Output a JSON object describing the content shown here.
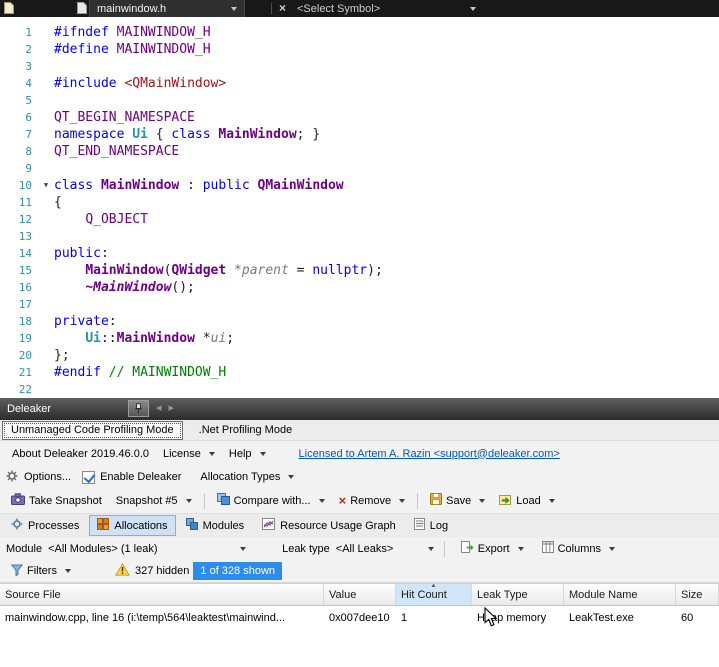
{
  "icons": {
    "dropdown": "▾",
    "close": "×",
    "remove": "×",
    "back": "◂",
    "forward": "▸",
    "fold": "▼",
    "sort": "▲"
  },
  "editor_bar": {
    "tab_title": "mainwindow.h",
    "symbol_selector": "<Select Symbol>"
  },
  "editor": {
    "lines": [
      {
        "n": "1",
        "s": [
          {
            "t": "#ifndef ",
            "c": "kw"
          },
          {
            "t": "MAINWINDOW_H",
            "c": "macro"
          }
        ]
      },
      {
        "n": "2",
        "s": [
          {
            "t": "#define ",
            "c": "kw"
          },
          {
            "t": "MAINWINDOW_H",
            "c": "macro"
          }
        ]
      },
      {
        "n": "3",
        "s": []
      },
      {
        "n": "4",
        "s": [
          {
            "t": "#include ",
            "c": "kw"
          },
          {
            "t": "<QMainWindow>",
            "c": "inc"
          }
        ]
      },
      {
        "n": "5",
        "s": []
      },
      {
        "n": "6",
        "s": [
          {
            "t": "QT_BEGIN_NAMESPACE",
            "c": "macro"
          }
        ]
      },
      {
        "n": "7",
        "s": [
          {
            "t": "namespace ",
            "c": "kw"
          },
          {
            "t": "Ui",
            "c": "ns"
          },
          {
            "t": " { ",
            "c": "pl"
          },
          {
            "t": "class ",
            "c": "kw"
          },
          {
            "t": "MainWindow",
            "c": "cls"
          },
          {
            "t": "; }",
            "c": "pl"
          }
        ]
      },
      {
        "n": "8",
        "s": [
          {
            "t": "QT_END_NAMESPACE",
            "c": "macro"
          }
        ]
      },
      {
        "n": "9",
        "s": []
      },
      {
        "n": "10",
        "fold": true,
        "s": [
          {
            "t": "class ",
            "c": "kw"
          },
          {
            "t": "MainWindow",
            "c": "cls"
          },
          {
            "t": " : ",
            "c": "pl"
          },
          {
            "t": "public ",
            "c": "kw"
          },
          {
            "t": "QMainWindow",
            "c": "cls"
          }
        ]
      },
      {
        "n": "11",
        "s": [
          {
            "t": "{",
            "c": "pl"
          }
        ]
      },
      {
        "n": "12",
        "s": [
          {
            "t": "    ",
            "c": "pl"
          },
          {
            "t": "Q_OBJECT",
            "c": "macro"
          }
        ]
      },
      {
        "n": "13",
        "s": []
      },
      {
        "n": "14",
        "s": [
          {
            "t": "public",
            "c": "kw"
          },
          {
            "t": ":",
            "c": "pl"
          }
        ]
      },
      {
        "n": "15",
        "s": [
          {
            "t": "    ",
            "c": "pl"
          },
          {
            "t": "MainWindow",
            "c": "cls"
          },
          {
            "t": "(",
            "c": "pl"
          },
          {
            "t": "QWidget",
            "c": "cls"
          },
          {
            "t": " ",
            "c": "pl"
          },
          {
            "t": "*parent",
            "c": "param"
          },
          {
            "t": " = ",
            "c": "pl"
          },
          {
            "t": "nullptr",
            "c": "kw"
          },
          {
            "t": ");",
            "c": "pl"
          }
        ]
      },
      {
        "n": "16",
        "s": [
          {
            "t": "    ",
            "c": "pl"
          },
          {
            "t": "~MainWindow",
            "c": "dtor"
          },
          {
            "t": "();",
            "c": "pl"
          }
        ]
      },
      {
        "n": "17",
        "s": []
      },
      {
        "n": "18",
        "s": [
          {
            "t": "private",
            "c": "kw"
          },
          {
            "t": ":",
            "c": "pl"
          }
        ]
      },
      {
        "n": "19",
        "s": [
          {
            "t": "    ",
            "c": "pl"
          },
          {
            "t": "Ui",
            "c": "ns"
          },
          {
            "t": "::",
            "c": "pl"
          },
          {
            "t": "MainWindow",
            "c": "cls"
          },
          {
            "t": " *",
            "c": "pl"
          },
          {
            "t": "ui",
            "c": "param"
          },
          {
            "t": ";",
            "c": "pl"
          }
        ]
      },
      {
        "n": "20",
        "s": [
          {
            "t": "};",
            "c": "pl"
          }
        ]
      },
      {
        "n": "21",
        "s": [
          {
            "t": "#endif ",
            "c": "kw"
          },
          {
            "t": "// MAINWINDOW_H",
            "c": "cm"
          }
        ]
      },
      {
        "n": "22",
        "s": []
      }
    ]
  },
  "deleaker": {
    "title": "Deleaker",
    "mode_tabs": {
      "unmanaged": "Unmanaged Code Profiling Mode",
      "net": ".Net Profiling Mode"
    },
    "menu": {
      "about": "About Deleaker 2019.46.0.0",
      "license": "License",
      "help": "Help",
      "license_link": "Licensed to Artem A. Razin <support@deleaker.com>"
    },
    "options_row": {
      "options": "Options...",
      "enable": "Enable Deleaker",
      "allocation_types": "Allocation Types"
    },
    "snapshot_row": {
      "take_snapshot": "Take Snapshot",
      "snapshot": "Snapshot #5",
      "compare": "Compare with...",
      "remove": "Remove",
      "save": "Save",
      "load": "Load"
    },
    "view_tabs": {
      "processes": "Processes",
      "allocations": "Allocations",
      "modules": "Modules",
      "graph": "Resource Usage Graph",
      "log": "Log"
    },
    "filter_row": {
      "module_label": "Module",
      "module_value": "<All Modules> (1 leak)",
      "leaktype_label": "Leak type",
      "leaktype_value": "<All Leaks>",
      "export": "Export",
      "columns": "Columns"
    },
    "filters_row": {
      "filters": "Filters",
      "hidden": "327 hidden",
      "shown": "1 of 328 shown"
    },
    "table": {
      "columns": [
        "Source File",
        "Value",
        "Hit Count",
        "Leak Type",
        "Module Name",
        "Size"
      ],
      "rows": [
        [
          "mainwindow.cpp, line 16 (i:\\temp\\564\\leaktest\\mainwind...",
          "0x007dee10",
          "1",
          "Heap memory",
          "LeakTest.exe",
          "60"
        ]
      ]
    }
  }
}
